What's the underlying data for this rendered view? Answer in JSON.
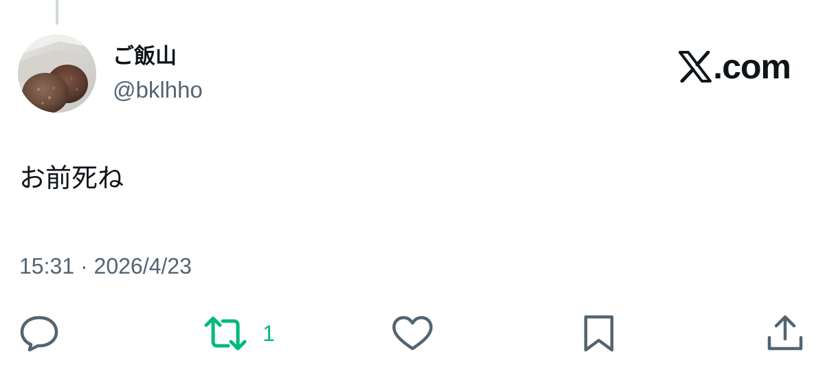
{
  "post": {
    "author": {
      "display_name": "ご飯山",
      "handle": "@bklhho"
    },
    "brand": {
      "text": ".com",
      "logo_icon": "x-logo-icon"
    },
    "text": "お前死ね",
    "timestamp": "15:31 · 2026/4/23"
  },
  "actions": {
    "reply": {
      "icon": "reply-icon"
    },
    "repost": {
      "icon": "repost-icon",
      "count": "1",
      "color": "#00ba7c"
    },
    "like": {
      "icon": "heart-icon"
    },
    "bookmark": {
      "icon": "bookmark-icon"
    },
    "share": {
      "icon": "share-icon"
    }
  },
  "colors": {
    "text_primary": "#0f1419",
    "text_secondary": "#536471",
    "repost_active": "#00ba7c",
    "thread_line": "#cfd9de"
  }
}
